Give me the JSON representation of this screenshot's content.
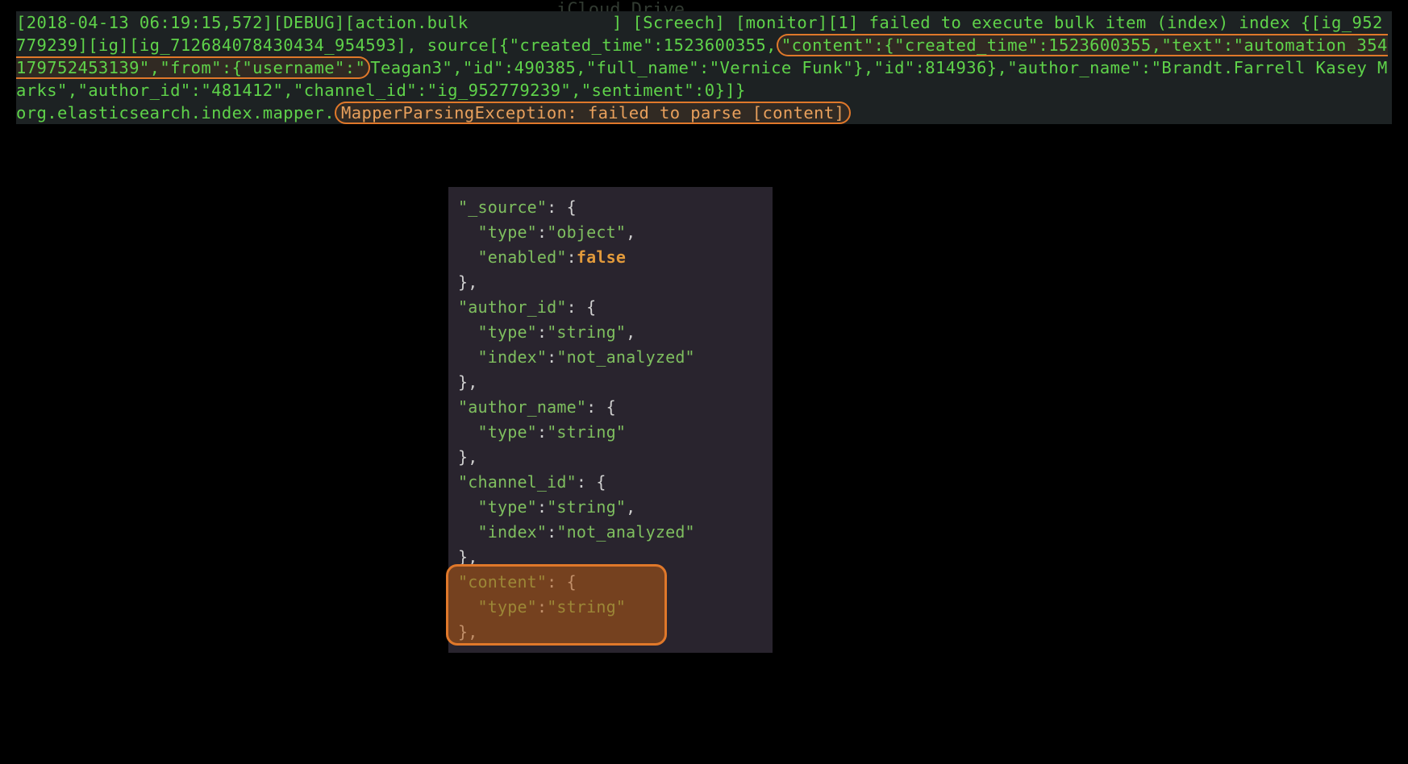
{
  "log": {
    "pre1": "[2018-04-13 06:19:15,572][DEBUG][action.bulk              ] [Screech] [monitor][1] failed to execute bulk item (index) index {[ig_952779239][ig][ig_712684078430434_954593], source[{\"created_time\":1523600355,",
    "hl1": "\"content\":{\"created_time\":1523600355,\"text\":\"automation 354179752453139\",\"from\":{\"username\":\"",
    "post1": "Teagan3\",\"id\":490385,\"full_name\":\"Vernice Funk\"},\"id\":814936},\"author_name\":\"Brandt.Farrell Kasey Marks\",\"author_id\":\"481412\",\"channel_id\":\"ig_952779239\",\"sentiment\":0}]}\norg.elasticsearch.index.mapper.",
    "hl2": "MapperParsingException: failed to parse [content]",
    "faint_top": "iCloud Drive"
  },
  "snippet": {
    "l01a": "\"_source\"",
    "l01b": ": {",
    "l02a": "  \"type\"",
    "l02b": ":",
    "l02c": "\"object\"",
    "l02d": ",",
    "l03a": "  \"enabled\"",
    "l03b": ":",
    "l03c": "false",
    "l04": "},",
    "l05a": "\"author_id\"",
    "l05b": ": {",
    "l06a": "  \"type\"",
    "l06b": ":",
    "l06c": "\"string\"",
    "l06d": ",",
    "l07a": "  \"index\"",
    "l07b": ":",
    "l07c": "\"not_analyzed\"",
    "l08": "},",
    "l09a": "\"author_name\"",
    "l09b": ": {",
    "l10a": "  \"type\"",
    "l10b": ":",
    "l10c": "\"string\"",
    "l11": "},",
    "l12a": "\"channel_id\"",
    "l12b": ": {",
    "l13a": "  \"type\"",
    "l13b": ":",
    "l13c": "\"string\"",
    "l13d": ",",
    "l14a": "  \"index\"",
    "l14b": ":",
    "l14c": "\"not_analyzed\"",
    "l15": "},",
    "l16a": "\"content\"",
    "l16b": ": {",
    "l17a": "  \"type\"",
    "l17b": ":",
    "l17c": "\"string\"",
    "l18": "},"
  }
}
